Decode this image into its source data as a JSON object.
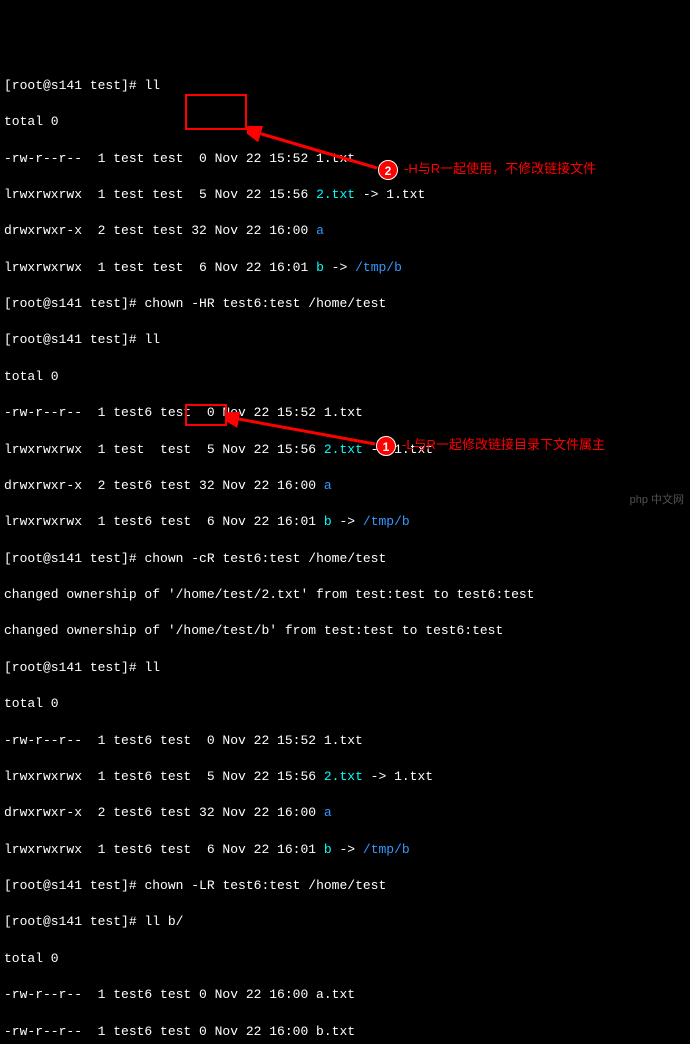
{
  "lines": {
    "l1_prompt": "[root@s141 test]# ",
    "l1_cmd": "ll",
    "l2": "total 0",
    "l3": "-rw-r--r--  1 test test  0 Nov 22 15:52 1.txt",
    "l4a": "lrwxrwxrwx  1 test test  5 Nov 22 15:56 ",
    "l4b": "2.txt",
    "l4c": " -> 1.txt",
    "l5a": "drwxrwxr-x  2 test test 32 Nov 22 16:00 ",
    "l5b": "a",
    "l6a": "lrwxrwxrwx  1 test test  6 Nov 22 16:01 ",
    "l6b": "b",
    "l6c": " -> ",
    "l6d": "/tmp/b",
    "l7_prompt": "[root@s141 test]# ",
    "l7_cmd": "chown -HR test6:test /home/test",
    "l8_prompt": "[root@s141 test]# ",
    "l8_cmd": "ll",
    "l9": "total 0",
    "l10": "-rw-r--r--  1 test6 test  0 Nov 22 15:52 1.txt",
    "l11a": "lrwxrwxrwx  1 test  test  5 Nov 22 15:56 ",
    "l11b": "2.txt",
    "l11c": " -> 1.txt",
    "l12a": "drwxrwxr-x  2 test6 test 32 Nov 22 16:00 ",
    "l12b": "a",
    "l13a": "lrwxrwxrwx  1 test6 test  6 Nov 22 16:01 ",
    "l13b": "b",
    "l13c": " -> ",
    "l13d": "/tmp/b",
    "l14_prompt": "[root@s141 test]# ",
    "l14_cmd": "chown -cR test6:test /home/test",
    "l15": "changed ownership of '/home/test/2.txt' from test:test to test6:test",
    "l16": "changed ownership of '/home/test/b' from test:test to test6:test",
    "l17_prompt": "[root@s141 test]# ",
    "l17_cmd": "ll",
    "l18": "total 0",
    "l19": "-rw-r--r--  1 test6 test  0 Nov 22 15:52 1.txt",
    "l20a": "lrwxrwxrwx  1 test6 test  5 Nov 22 15:56 ",
    "l20b": "2.txt",
    "l20c": " -> 1.txt",
    "l21a": "drwxrwxr-x  2 test6 test 32 Nov 22 16:00 ",
    "l21b": "a",
    "l22a": "lrwxrwxrwx  1 test6 test  6 Nov 22 16:01 ",
    "l22b": "b",
    "l22c": " -> ",
    "l22d": "/tmp/b",
    "l23_prompt": "[root@s141 test]# ",
    "l23_cmd": "chown -LR test6:test /home/test",
    "l24_prompt": "[root@s141 test]# ",
    "l24_cmd": "ll b/",
    "l25": "total 0",
    "l26": "-rw-r--r--  1 test6 test 0 Nov 22 16:00 a.txt",
    "l27": "-rw-r--r--  1 test6 test 0 Nov 22 16:00 b.txt"
  },
  "annotations": {
    "num1": "1",
    "num2": "2",
    "text1": "-L与R一起修改链接目录下文件属主",
    "text2": "-H与R一起使用，不修改链接文件"
  },
  "watermark": "php 中文网"
}
